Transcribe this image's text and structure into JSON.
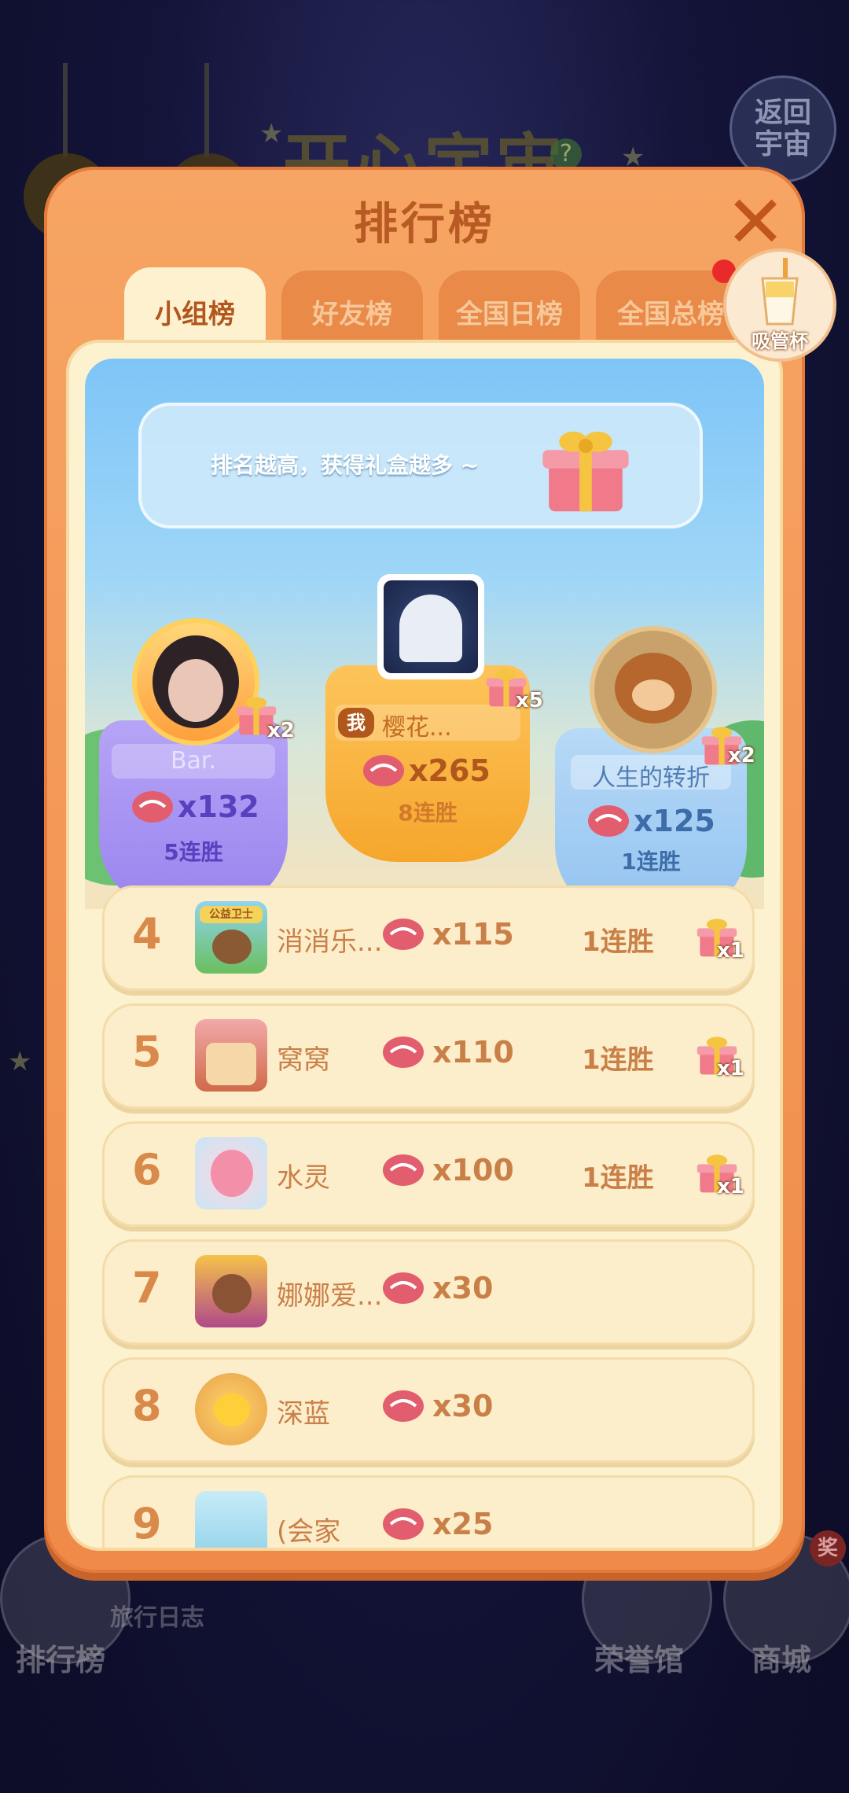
{
  "background": {
    "title": "开心宇宙",
    "back_button": "返回宇宙",
    "bottom_nav": {
      "rank_label": "排行榜",
      "diary_label": "旅行日志",
      "honor_label": "荣誉馆",
      "shop_label": "商城",
      "shop_badge": "奖"
    }
  },
  "modal": {
    "title": "排行榜",
    "tabs": [
      "小组榜",
      "好友榜",
      "全国日榜",
      "全国总榜"
    ],
    "active_tab": 0,
    "straw_cup_label": "吸管杯",
    "tip": "排名越高，获得礼盒越多 ~",
    "me_tag": "我",
    "podium": [
      {
        "rank": 2,
        "name": "Bar.",
        "count": "x132",
        "streak": "5连胜",
        "gift": "x2"
      },
      {
        "rank": 1,
        "name": "樱花...",
        "count": "x265",
        "streak": "8连胜",
        "gift": "x5"
      },
      {
        "rank": 3,
        "name": "人生的转折",
        "count": "x125",
        "streak": "1连胜",
        "gift": "x2"
      }
    ],
    "rows": [
      {
        "rank": "4",
        "name": "消消乐...",
        "count": "x115",
        "streak": "1连胜",
        "gift": "x1",
        "avatar_text": "公益卫士"
      },
      {
        "rank": "5",
        "name": "窝窝",
        "count": "x110",
        "streak": "1连胜",
        "gift": "x1"
      },
      {
        "rank": "6",
        "name": "水灵",
        "count": "x100",
        "streak": "1连胜",
        "gift": "x1"
      },
      {
        "rank": "7",
        "name": "娜娜爱...",
        "count": "x30"
      },
      {
        "rank": "8",
        "name": "深蓝",
        "count": "x30"
      },
      {
        "rank": "9",
        "name": "(会家",
        "count": "x25"
      }
    ]
  },
  "colors": {
    "modal_orange": "#f39a55",
    "panel_cream": "#fdf2cf",
    "text_brown": "#c98048",
    "first_gold": "#f9b23a",
    "second_purple": "#a38ef0",
    "third_blue": "#9cc8f2"
  }
}
